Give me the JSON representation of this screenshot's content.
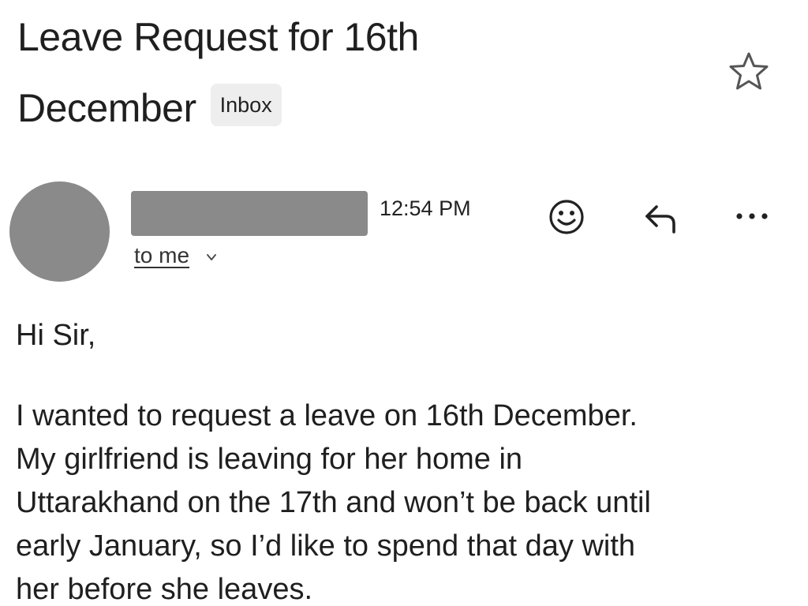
{
  "email": {
    "subject_line1": "Leave Request for 16th",
    "subject_line2": "December",
    "label_badge": "Inbox",
    "recipient_text": "to me",
    "time": "12:54 PM",
    "greeting": "Hi Sir,",
    "body_lines": [
      "I wanted to request a leave on 16th December.",
      "My girlfriend is leaving for her home in",
      "Uttarakhand on the 17th and won’t be back until",
      "early January, so I’d like to spend that day with",
      "her before she leaves."
    ]
  },
  "icons": {
    "star": "star-outline-icon",
    "emoji": "smiley-face-icon",
    "reply": "reply-arrow-icon",
    "more": "more-horizontal-icon",
    "chevron": "chevron-down-icon"
  },
  "colors": {
    "redaction": "#8a8a8a",
    "badge_bg": "#eeeeee",
    "text": "#1f1f1f"
  }
}
